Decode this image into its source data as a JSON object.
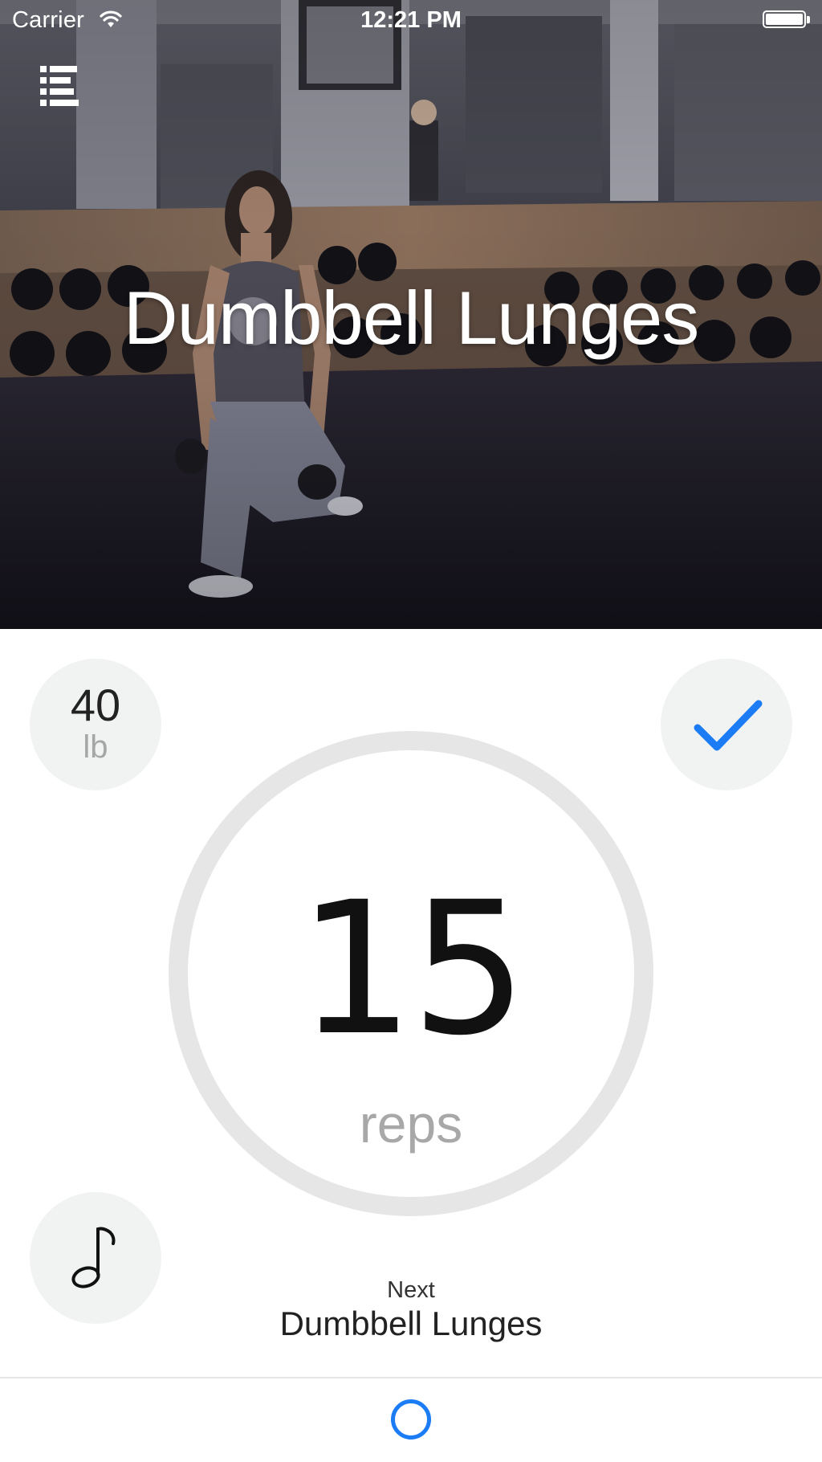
{
  "status_bar": {
    "carrier": "Carrier",
    "time": "12:21 PM",
    "wifi_icon": "wifi-icon",
    "battery_icon": "battery-icon"
  },
  "header": {
    "menu_icon": "list-menu-icon",
    "exercise_title": "Dumbbell Lunges"
  },
  "weight": {
    "value": "40",
    "unit": "lb"
  },
  "done": {
    "icon": "checkmark-icon",
    "color": "#1B7CF5"
  },
  "reps": {
    "count": "15",
    "label": "reps"
  },
  "music": {
    "icon": "music-note-icon"
  },
  "next_up": {
    "label": "Next",
    "exercise": "Dumbbell Lunges"
  },
  "footer": {
    "progress_icon": "circle-icon",
    "accent_color": "#1B7CF5"
  }
}
